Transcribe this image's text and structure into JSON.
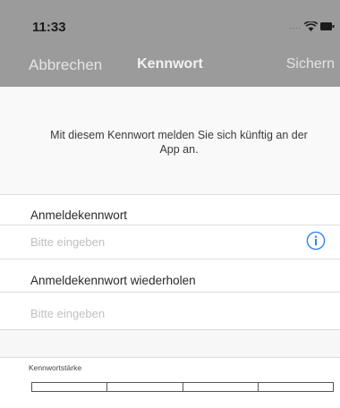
{
  "status_bar": {
    "time": "11:33",
    "signal": "....",
    "wifi_icon": "wifi-icon",
    "battery_icon": "battery-icon"
  },
  "nav": {
    "left_label": "Abbrechen",
    "title": "Kennwort",
    "right_label": "Sichern"
  },
  "intro": {
    "text": "Mit diesem Kennwort melden Sie sich künftig an der App an."
  },
  "fields": [
    {
      "label": "Anmeldekennwort",
      "placeholder": "Bitte eingeben",
      "value": ""
    },
    {
      "label": "Anmeldekennwort wiederholen",
      "placeholder": "Bitte eingeben",
      "value": ""
    }
  ],
  "strength": {
    "label": "Kennwortstärke",
    "segments": 4,
    "filled_segments": 0
  },
  "colors": {
    "bar": "#9b9b9b",
    "info_accent": "#2f80ed",
    "placeholder": "#c0c0c0"
  }
}
